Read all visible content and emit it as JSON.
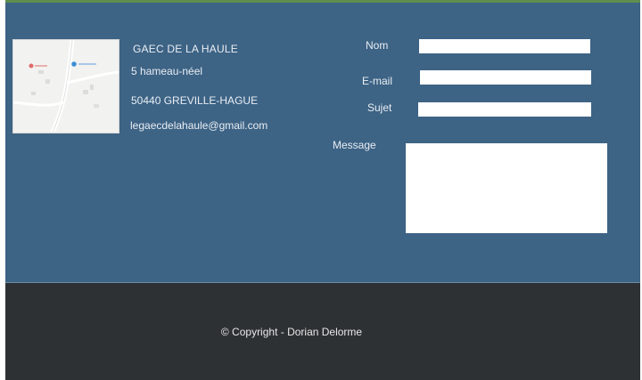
{
  "colors": {
    "contact_background": "#3d6385",
    "footer_background": "#2e3133",
    "top_strip": "#5f8f4e",
    "text": "#e9eef3"
  },
  "map": {
    "icon": "map-thumbnail"
  },
  "contact_info": {
    "name": "GAEC DE LA HAULE",
    "street": "5 hameau-néel",
    "city": "50440 GREVILLE-HAGUE",
    "email": "legaecdelahaule@gmail.com"
  },
  "form": {
    "nom_label": "Nom",
    "email_label": "E-mail",
    "sujet_label": "Sujet",
    "message_label": "Message",
    "nom_value": "",
    "email_value": "",
    "sujet_value": "",
    "message_value": ""
  },
  "footer": {
    "copyright": "© Copyright - Dorian Delorme"
  }
}
